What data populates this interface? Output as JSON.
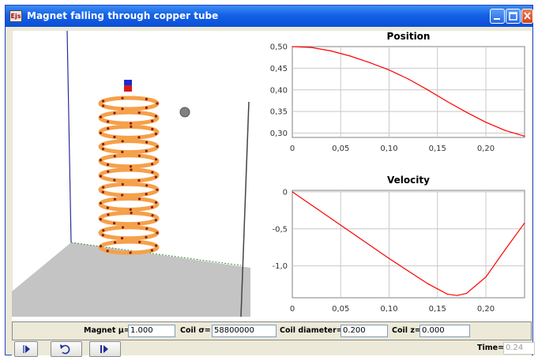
{
  "window": {
    "title": "Magnet falling through copper tube",
    "app_icon": "Ejs"
  },
  "params": {
    "magnet_mu_label": "Magnet μ=",
    "magnet_mu_value": "1.000",
    "coil_sigma_label": "Coil σ=",
    "coil_sigma_value": "58800000",
    "coil_diameter_label": "Coil diameter=",
    "coil_diameter_value": "0.200",
    "coil_z_label": "Coil z=",
    "coil_z_value": "0.000"
  },
  "controls": {
    "play_icon": "play-icon",
    "reset_icon": "reset-icon",
    "step_icon": "step-icon",
    "time_label": "Time=",
    "time_value": "0.24"
  },
  "chart_data": [
    {
      "type": "line",
      "title": "Position",
      "xlabel": "",
      "ylabel": "",
      "xlim": [
        0,
        0.24
      ],
      "ylim": [
        0.29,
        0.5
      ],
      "x_ticks": [
        "0",
        "0,05",
        "0,10",
        "0,15",
        "0,20"
      ],
      "y_ticks": [
        "0,50",
        "0,45",
        "0,40",
        "0,35",
        "0,30"
      ],
      "grid": true,
      "color": "#ff0000",
      "x": [
        0,
        0.02,
        0.04,
        0.06,
        0.08,
        0.1,
        0.12,
        0.14,
        0.16,
        0.18,
        0.2,
        0.22,
        0.24
      ],
      "y": [
        0.5,
        0.498,
        0.49,
        0.478,
        0.463,
        0.446,
        0.425,
        0.4,
        0.373,
        0.348,
        0.325,
        0.306,
        0.293
      ]
    },
    {
      "type": "line",
      "title": "Velocity",
      "xlabel": "",
      "ylabel": "",
      "xlim": [
        0,
        0.24
      ],
      "ylim": [
        -1.43,
        0.02
      ],
      "x_ticks": [
        "0",
        "0,05",
        "0,10",
        "0,15",
        "0,20"
      ],
      "y_ticks": [
        "0",
        "-0,5",
        "-1,0"
      ],
      "grid": true,
      "color": "#ff0000",
      "x": [
        0,
        0.02,
        0.04,
        0.06,
        0.08,
        0.1,
        0.12,
        0.14,
        0.16,
        0.17,
        0.18,
        0.2,
        0.22,
        0.24
      ],
      "y": [
        0,
        -0.18,
        -0.36,
        -0.54,
        -0.72,
        -0.9,
        -1.07,
        -1.24,
        -1.38,
        -1.4,
        -1.37,
        -1.15,
        -0.78,
        -0.42
      ]
    }
  ]
}
